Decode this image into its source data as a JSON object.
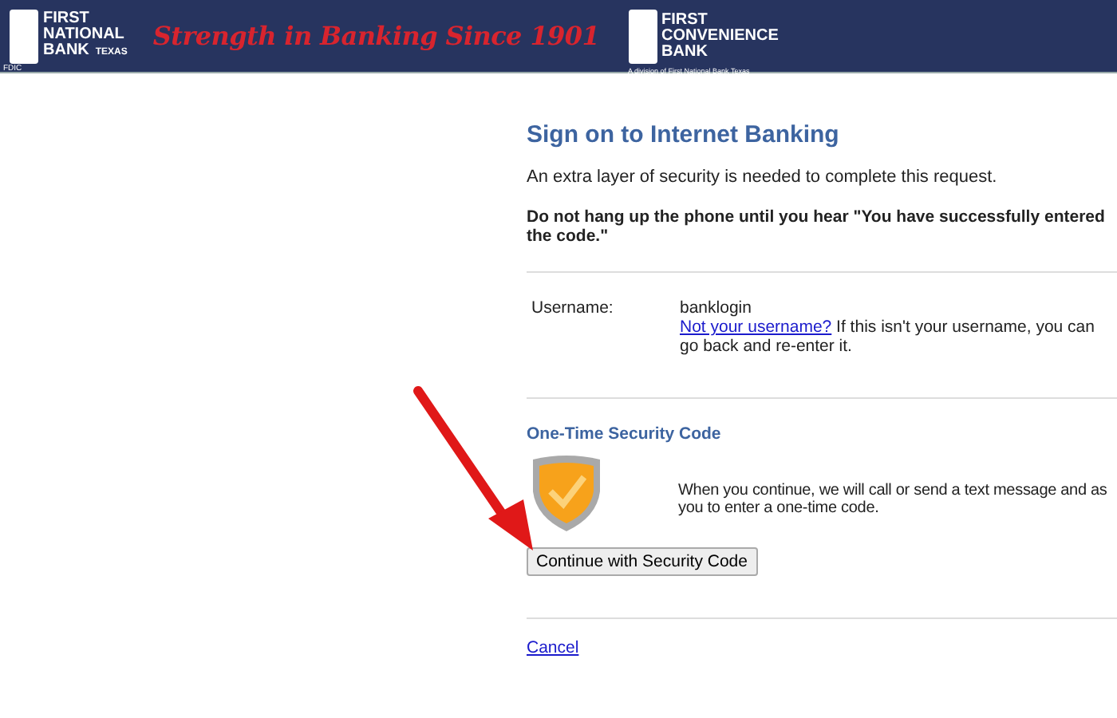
{
  "banner": {
    "bank_logo": {
      "line_1": "FIRST",
      "line_2": "NATIONAL",
      "line_3": "BANK",
      "state": "TEXAS",
      "fdic": "FDIC"
    },
    "slogan": "Strength in Banking Since 1901",
    "second_logo": {
      "line_1": "FIRST",
      "line_2": "CONVENIENCE",
      "line_3": "BANK",
      "tagline": "A division of First National Bank Texas"
    }
  },
  "title": "Sign on to Internet Banking",
  "intro": "An extra layer of security is needed to complete this request.",
  "warning": "Do not hang up the phone until you hear \"You have successfully entered the code.\"",
  "username": {
    "label": "Username:",
    "value": "banklogin",
    "link": "Not your username?",
    "note": "If this isn't your username, you can go back and re-enter it."
  },
  "security": {
    "heading": "One-Time Security Code",
    "lines": [
      "When you continue, we will call or send a text message and as",
      "you to enter a one-time code."
    ],
    "button": "Continue with Security Code"
  },
  "cancel": "Cancel"
}
